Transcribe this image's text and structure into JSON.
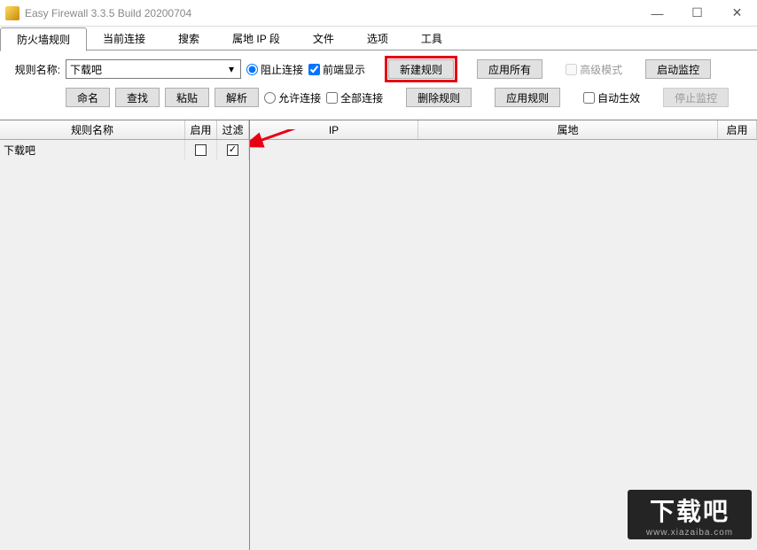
{
  "window": {
    "title": "Easy Firewall 3.3.5 Build 20200704"
  },
  "tabs": [
    {
      "label": "防火墙规则",
      "active": true
    },
    {
      "label": "当前连接",
      "active": false
    },
    {
      "label": "搜索",
      "active": false
    },
    {
      "label": "属地 IP 段",
      "active": false
    },
    {
      "label": "文件",
      "active": false
    },
    {
      "label": "选项",
      "active": false
    },
    {
      "label": "工具",
      "active": false
    }
  ],
  "toolbar": {
    "rule_name_label": "规则名称:",
    "rule_name_value": "下载吧",
    "radio_block": "阻止连接",
    "radio_allow": "允许连接",
    "check_frontend": "前端显示",
    "check_all_conn": "全部连接",
    "btn_new_rule": "新建规则",
    "btn_del_rule": "删除规则",
    "btn_apply_all": "应用所有",
    "btn_apply_rule": "应用规则",
    "check_advanced": "高级模式",
    "check_auto_effect": "自动生效",
    "btn_start_monitor": "启动监控",
    "btn_stop_monitor": "停止监控",
    "btn_rename": "命名",
    "btn_find": "查找",
    "btn_paste": "粘贴",
    "btn_parse": "解析"
  },
  "left_grid": {
    "headers": {
      "name": "规则名称",
      "enable": "启用",
      "filter": "过滤"
    },
    "rows": [
      {
        "name": "下载吧",
        "enable": false,
        "filter": true
      }
    ]
  },
  "right_grid": {
    "headers": {
      "ip": "IP",
      "loc": "属地",
      "enable": "启用"
    }
  },
  "watermark": {
    "text": "下载吧",
    "url": "www.xiazaiba.com"
  }
}
